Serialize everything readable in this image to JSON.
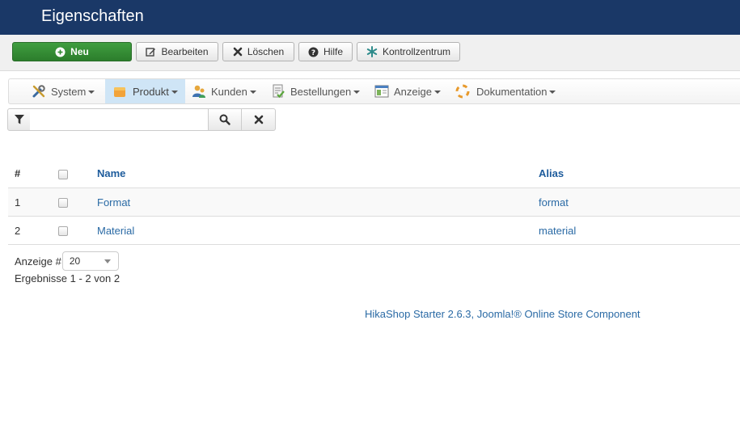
{
  "header": {
    "title": "Eigenschaften"
  },
  "toolbar": {
    "new_label": "Neu",
    "edit_label": "Bearbeiten",
    "delete_label": "Löschen",
    "help_label": "Hilfe",
    "dashboard_label": "Kontrollzentrum",
    "success_color": "#348f34"
  },
  "menu": {
    "items": [
      {
        "label": "System",
        "icon": "tools-icon"
      },
      {
        "label": "Produkt",
        "icon": "box-icon",
        "active": true
      },
      {
        "label": "Kunden",
        "icon": "users-icon"
      },
      {
        "label": "Bestellungen",
        "icon": "orders-icon"
      },
      {
        "label": "Anzeige",
        "icon": "display-icon"
      },
      {
        "label": "Dokumentation",
        "icon": "lifebuoy-icon"
      }
    ],
    "active_color": "#cfe5f6"
  },
  "filter": {
    "search_value": "",
    "search_placeholder": ""
  },
  "table": {
    "headers": {
      "num": "#",
      "name": "Name",
      "alias": "Alias"
    },
    "rows": [
      {
        "num": "1",
        "name": "Format",
        "alias": "format"
      },
      {
        "num": "2",
        "name": "Material",
        "alias": "material"
      }
    ]
  },
  "pagination": {
    "limit_label": "Anzeige #",
    "limit_value": "20",
    "results_text": "Ergebnisse 1 - 2 von 2"
  },
  "footer": {
    "text": "HikaShop Starter 2.6.3, Joomla!® Online Store Component"
  },
  "colors": {
    "header_bg": "#1a3867",
    "link": "#2a6aa5"
  }
}
